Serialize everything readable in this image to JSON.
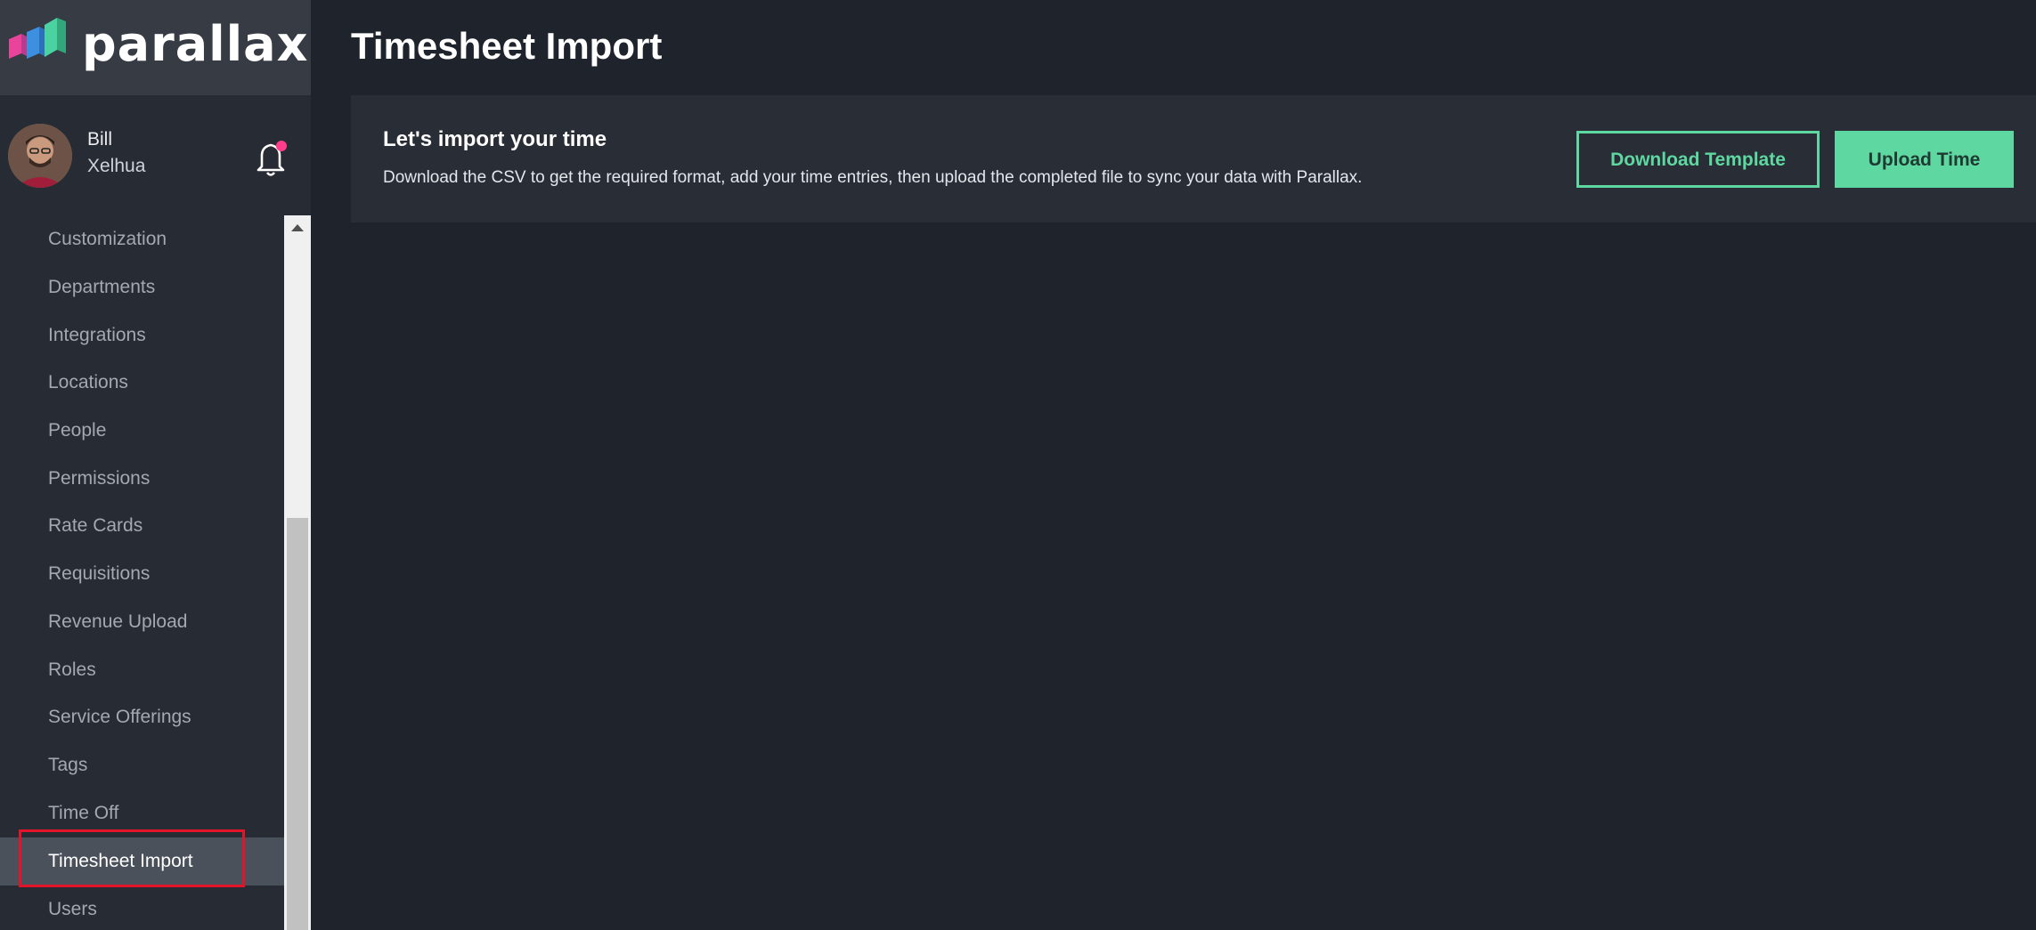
{
  "brand": {
    "name": "parallax",
    "logo_icon": "parallax-logo-icon"
  },
  "user": {
    "first_name": "Bill",
    "last_name": "Xelhua",
    "notification_icon": "bell-icon",
    "has_notification": true
  },
  "sidebar": {
    "items": [
      {
        "label": "Customization",
        "active": false
      },
      {
        "label": "Departments",
        "active": false
      },
      {
        "label": "Integrations",
        "active": false
      },
      {
        "label": "Locations",
        "active": false
      },
      {
        "label": "People",
        "active": false
      },
      {
        "label": "Permissions",
        "active": false
      },
      {
        "label": "Rate Cards",
        "active": false
      },
      {
        "label": "Requisitions",
        "active": false
      },
      {
        "label": "Revenue Upload",
        "active": false
      },
      {
        "label": "Roles",
        "active": false
      },
      {
        "label": "Service Offerings",
        "active": false
      },
      {
        "label": "Tags",
        "active": false
      },
      {
        "label": "Time Off",
        "active": false
      },
      {
        "label": "Timesheet Import",
        "active": true
      },
      {
        "label": "Users",
        "active": false
      }
    ]
  },
  "main": {
    "title": "Timesheet Import",
    "card": {
      "title": "Let's import your time",
      "description": "Download the CSV to get the required format, add your time entries, then upload the completed file to sync your data with Parallax.",
      "download_button": "Download Template",
      "upload_button": "Upload Time"
    }
  },
  "colors": {
    "accent": "#5ed8a0",
    "highlight": "#e2142a",
    "notification_dot": "#ff3d8b"
  }
}
